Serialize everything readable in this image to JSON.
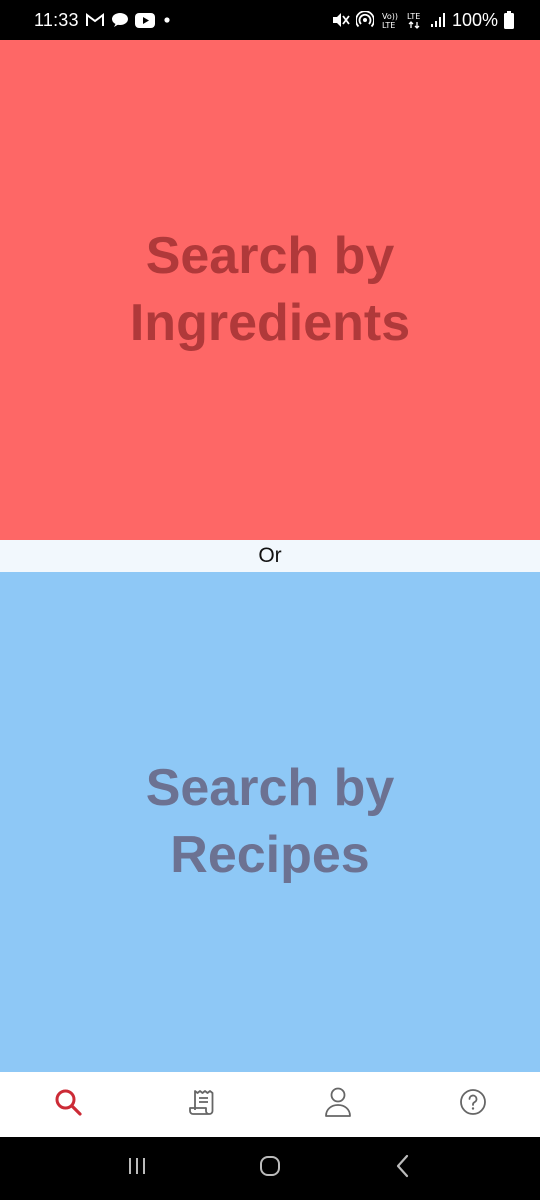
{
  "status_bar": {
    "time": "11:33",
    "battery": "100%",
    "icons_left": [
      "gmail-icon",
      "chat-icon",
      "youtube-icon",
      "dot-icon"
    ],
    "icons_right": [
      "mute-icon",
      "hotspot-icon",
      "volte-icon",
      "lte-icon",
      "signal-icon",
      "battery-icon"
    ],
    "volte_label": "Vo)) LTE",
    "lte_label": "LTE"
  },
  "search_ingredients": {
    "label": "Search by Ingredients",
    "background": "#fe6766",
    "text_color": "#b0393a"
  },
  "divider": {
    "label": "Or"
  },
  "search_recipes": {
    "label": "Search by Recipes",
    "background": "#8ec8f6",
    "text_color": "#6c7292"
  },
  "tab_bar": {
    "active_color": "#cc2b36",
    "inactive_color": "#666666",
    "tabs": [
      {
        "icon": "search-icon",
        "active": true
      },
      {
        "icon": "receipt-icon",
        "active": false
      },
      {
        "icon": "person-icon",
        "active": false
      },
      {
        "icon": "help-icon",
        "active": false
      }
    ]
  },
  "system_nav": {
    "buttons": [
      "recent-apps-icon",
      "home-icon",
      "back-icon"
    ]
  }
}
